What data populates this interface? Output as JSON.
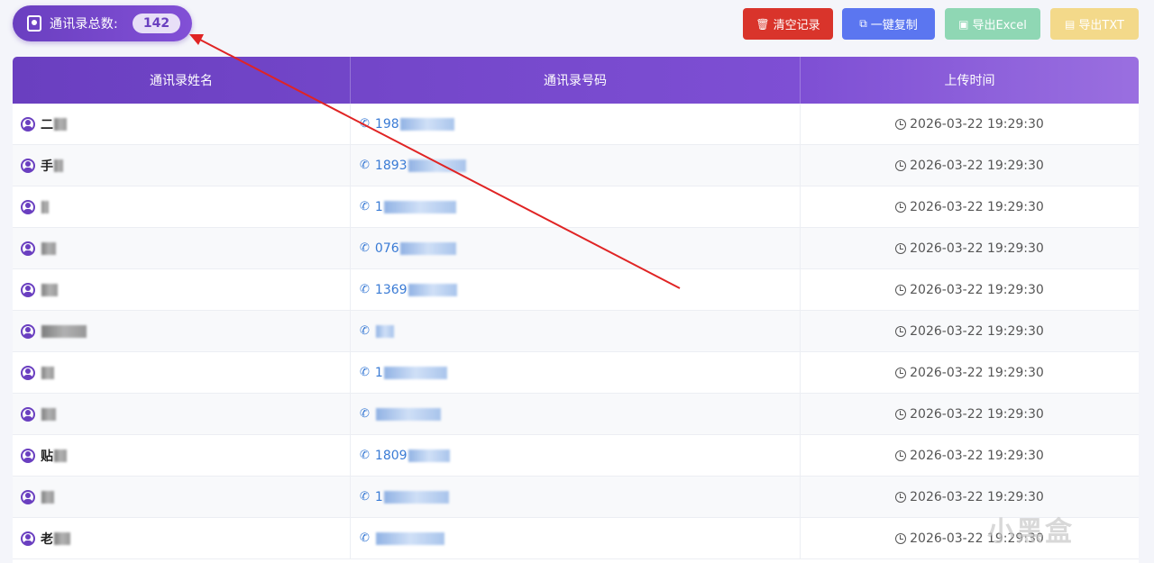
{
  "header": {
    "contacts_total_label": "通讯录总数:",
    "contacts_total": "142"
  },
  "toolbar": {
    "clear_label": "清空记录",
    "copy_label": "一键复制",
    "export_excel_label": "导出Excel",
    "export_txt_label": "导出TXT"
  },
  "table": {
    "columns": [
      "通讯录姓名",
      "通讯录号码",
      "上传时间"
    ],
    "rows": [
      {
        "name": "二",
        "phone": "198",
        "time": "2026-03-22 19:29:30"
      },
      {
        "name": "手",
        "phone": "1893",
        "time": "2026-03-22 19:29:30"
      },
      {
        "name": "",
        "phone": "1",
        "time": "2026-03-22 19:29:30"
      },
      {
        "name": "",
        "phone": "076",
        "time": "2026-03-22 19:29:30"
      },
      {
        "name": "",
        "phone": "1369",
        "time": "2026-03-22 19:29:30"
      },
      {
        "name": "",
        "phone": "",
        "time": "2026-03-22 19:29:30"
      },
      {
        "name": "",
        "phone": "1",
        "time": "2026-03-22 19:29:30"
      },
      {
        "name": "",
        "phone": "",
        "time": "2026-03-22 19:29:30"
      },
      {
        "name": "贴",
        "phone": "1809",
        "time": "2026-03-22 19:29:30"
      },
      {
        "name": "",
        "phone": "1",
        "time": "2026-03-22 19:29:30"
      },
      {
        "name": "老",
        "phone": "",
        "time": "2026-03-22 19:29:30"
      }
    ]
  },
  "watermark": "小黑盒",
  "colors": {
    "primary": "#6a3fc0",
    "danger": "#d9342b",
    "info": "#5b76f0",
    "success": "#8fd7b4",
    "warning": "#f3d98a",
    "annotation_arrow": "#e02424"
  }
}
